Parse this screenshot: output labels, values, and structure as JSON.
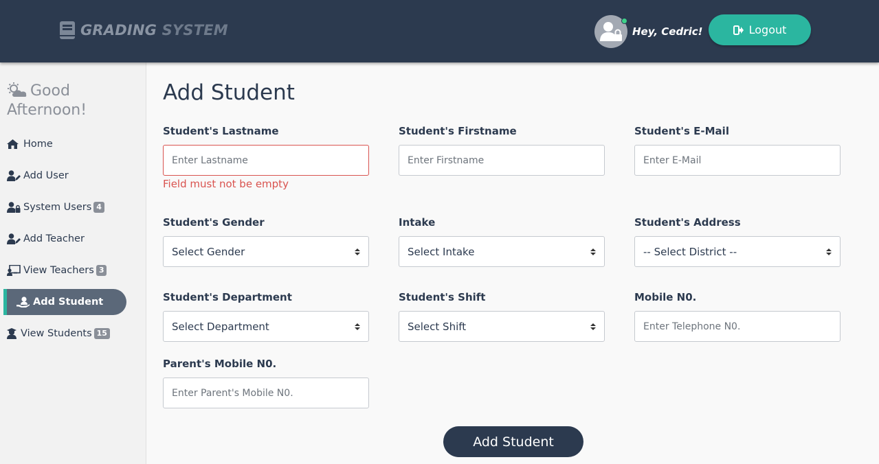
{
  "header": {
    "brand_part1": "GRADING",
    "brand_part2": "SYSTEM",
    "greeting": "Hey, Cedric!",
    "logout_label": "Logout",
    "brand_icon": "book-icon",
    "avatar_icon": "user-lock-icon",
    "online_status_color": "#3ed28a"
  },
  "sidebar": {
    "greeting": "Good Afternoon!",
    "greeting_icon": "cloud-sun-icon",
    "items": [
      {
        "label": "Home",
        "icon": "home-icon",
        "badge": ""
      },
      {
        "label": "Add User",
        "icon": "user-edit-icon",
        "badge": ""
      },
      {
        "label": "System Users",
        "icon": "user-lock-icon",
        "badge": "4"
      },
      {
        "label": "Add Teacher",
        "icon": "user-edit-icon",
        "badge": ""
      },
      {
        "label": "View Teachers",
        "icon": "chalkboard-teacher-icon",
        "badge": "3"
      },
      {
        "label": "Add Student",
        "icon": "hand-holding-user-icon",
        "badge": "",
        "active": true
      },
      {
        "label": "View Students",
        "icon": "user-graduate-icon",
        "badge": "15"
      }
    ]
  },
  "main": {
    "title": "Add Student",
    "fields": {
      "lastname": {
        "label": "Student's Lastname",
        "placeholder": "Enter Lastname",
        "error": "Field must not be empty"
      },
      "firstname": {
        "label": "Student's Firstname",
        "placeholder": "Enter Firstname"
      },
      "email": {
        "label": "Student's E-Mail",
        "placeholder": "Enter E-Mail"
      },
      "gender": {
        "label": "Student's Gender",
        "value": "Select Gender"
      },
      "intake": {
        "label": "Intake",
        "value": "Select Intake"
      },
      "address": {
        "label": "Student's Address",
        "value": "-- Select District --"
      },
      "department": {
        "label": "Student's Department",
        "value": "Select Department"
      },
      "shift": {
        "label": "Student's Shift",
        "value": "Select Shift"
      },
      "mobile": {
        "label": "Mobile N0.",
        "placeholder": "Enter Telephone N0."
      },
      "parent_mobile": {
        "label": "Parent's Mobile N0.",
        "placeholder": "Enter Parent's Mobile N0."
      }
    },
    "submit_label": "Add Student"
  },
  "colors": {
    "header_bg": "#2c3a4f",
    "accent": "#2bb6a0",
    "error": "#d9534f",
    "active_item_bg": "#5b6879"
  }
}
